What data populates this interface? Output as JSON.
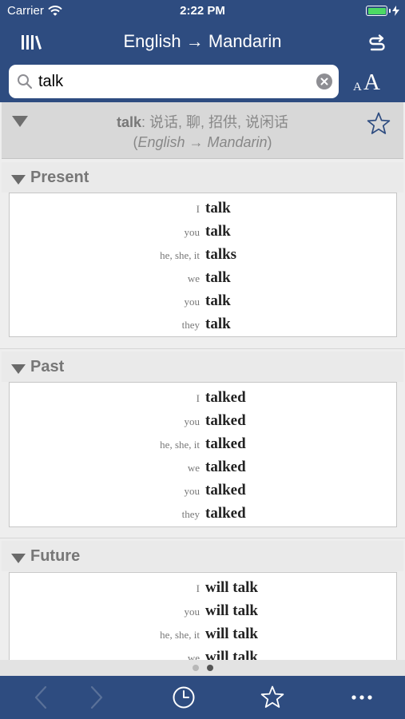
{
  "status": {
    "carrier": "Carrier",
    "time": "2:22 PM"
  },
  "nav": {
    "title": "English → Mandarin",
    "library_icon": "library-books-icon",
    "swap_icon": "swap-direction-icon"
  },
  "search": {
    "value": "talk",
    "clear_icon": "clear-icon",
    "font_size_small": "A",
    "font_size_large": "A"
  },
  "entry": {
    "headword": "talk",
    "translations": ": 说话, 聊, 招供, 说闲话",
    "direction_open": "(",
    "direction": "English → Mandarin",
    "direction_close": ")",
    "star_icon": "star-outline-icon"
  },
  "sections": [
    {
      "label": "Present",
      "rows": [
        {
          "pronoun": "I",
          "form": "talk"
        },
        {
          "pronoun": "you",
          "form": "talk"
        },
        {
          "pronoun": "he, she, it",
          "form": "talks"
        },
        {
          "pronoun": "we",
          "form": "talk"
        },
        {
          "pronoun": "you",
          "form": "talk"
        },
        {
          "pronoun": "they",
          "form": "talk"
        }
      ]
    },
    {
      "label": "Past",
      "rows": [
        {
          "pronoun": "I",
          "form": "talked"
        },
        {
          "pronoun": "you",
          "form": "talked"
        },
        {
          "pronoun": "he, she, it",
          "form": "talked"
        },
        {
          "pronoun": "we",
          "form": "talked"
        },
        {
          "pronoun": "you",
          "form": "talked"
        },
        {
          "pronoun": "they",
          "form": "talked"
        }
      ]
    },
    {
      "label": "Future",
      "rows": [
        {
          "pronoun": "I",
          "form": "will talk"
        },
        {
          "pronoun": "you",
          "form": "will talk"
        },
        {
          "pronoun": "he, she, it",
          "form": "will talk"
        },
        {
          "pronoun": "we",
          "form": "will talk"
        }
      ]
    }
  ],
  "pager": {
    "page_count": 2,
    "current_page": 2
  },
  "toolbar": {
    "icons": [
      "back-arrow-icon",
      "forward-arrow-icon",
      "history-clock-icon",
      "favorites-star-icon",
      "more-ellipsis-icon"
    ]
  },
  "colors": {
    "nav_bg": "#2e4c80",
    "accent_white": "#ffffff",
    "battery_green": "#4cd964",
    "disabled_arrow": "#5a7199"
  }
}
